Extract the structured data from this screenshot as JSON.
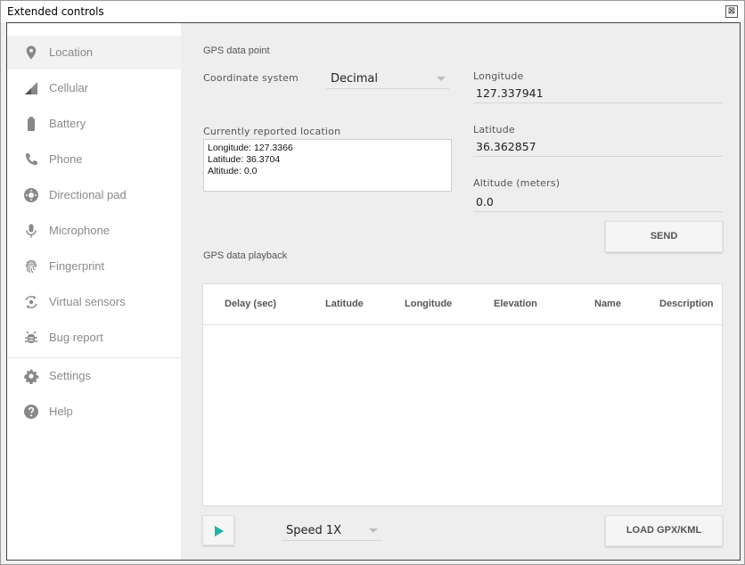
{
  "window": {
    "title": "Extended controls",
    "close_glyph": "⊠"
  },
  "sidebar": {
    "items": [
      {
        "label": "Location",
        "icon": "location-pin-icon",
        "active": true
      },
      {
        "label": "Cellular",
        "icon": "signal-icon"
      },
      {
        "label": "Battery",
        "icon": "battery-icon"
      },
      {
        "label": "Phone",
        "icon": "phone-icon"
      },
      {
        "label": "Directional pad",
        "icon": "dpad-icon"
      },
      {
        "label": "Microphone",
        "icon": "microphone-icon"
      },
      {
        "label": "Fingerprint",
        "icon": "fingerprint-icon"
      },
      {
        "label": "Virtual sensors",
        "icon": "rotate-icon"
      },
      {
        "label": "Bug report",
        "icon": "bug-icon"
      },
      {
        "label": "Settings",
        "icon": "gear-icon"
      },
      {
        "label": "Help",
        "icon": "help-icon"
      }
    ],
    "icon_color": "#888888"
  },
  "gps_point": {
    "section_label": "GPS data point",
    "coord_system_label": "Coordinate system",
    "coord_system_value": "Decimal",
    "longitude_label": "Longitude",
    "longitude_value": "127.337941",
    "latitude_label": "Latitude",
    "latitude_value": "36.362857",
    "altitude_label": "Altitude (meters)",
    "altitude_value": "0.0",
    "reported_label": "Currently reported location",
    "reported_lines": [
      "Longitude: 127.3366",
      "Latitude: 36.3704",
      "Altitude: 0.0"
    ],
    "send_label": "SEND"
  },
  "playback": {
    "section_label": "GPS data playback",
    "columns": [
      "Delay (sec)",
      "Latitude",
      "Longitude",
      "Elevation",
      "Name",
      "Description"
    ],
    "rows": [],
    "speed_value": "Speed 1X",
    "load_label": "LOAD GPX/KML",
    "accent_color": "#1db3a6"
  }
}
